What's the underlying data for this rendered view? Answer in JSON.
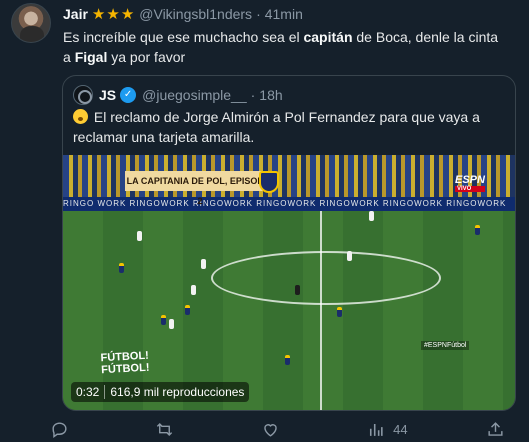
{
  "tweet": {
    "author_name": "Jair",
    "stars": "★★★",
    "handle": "@Vikingsbl1nders",
    "dot": "·",
    "time": "41min",
    "text_part1": "Es increíble que ese muchacho sea el ",
    "text_bold1": "capitán",
    "text_part2": " de Boca, denle la cinta a ",
    "text_bold2": "Figal",
    "text_part3": " ya por favor"
  },
  "quote": {
    "author_name": "JS",
    "handle": "@juegosimple__",
    "dot": "·",
    "time": "18h",
    "text": "El reclamo de Jorge Almirón a Pol Fernandez para que vaya a reclamar una tarjeta amarilla.",
    "video": {
      "banner": "LA CAPITANIA DE POL, EPISODIO 2",
      "ad_text": "RINGO WORK    RINGOWORK    RINGOWORK    RINGOWORK    RINGOWORK    RINGOWORK    RINGOWORK",
      "broadcaster": "ESPN",
      "broadcaster_sub": "VIVO",
      "hashtag": "#ESPNFútbol",
      "logo": "FÚTBOL! FÚTBOL!",
      "duration": "0:32",
      "views": "616,9 mil reproducciones"
    }
  },
  "actions": {
    "reply_count": "",
    "retweet_count": "",
    "like_count": "",
    "views_count": "44"
  },
  "colors": {
    "background": "#15202b",
    "text": "#e7e9ea",
    "muted": "#8b98a5",
    "border": "#38444d",
    "verified": "#1d9bf0",
    "stars": "#f4b400"
  }
}
